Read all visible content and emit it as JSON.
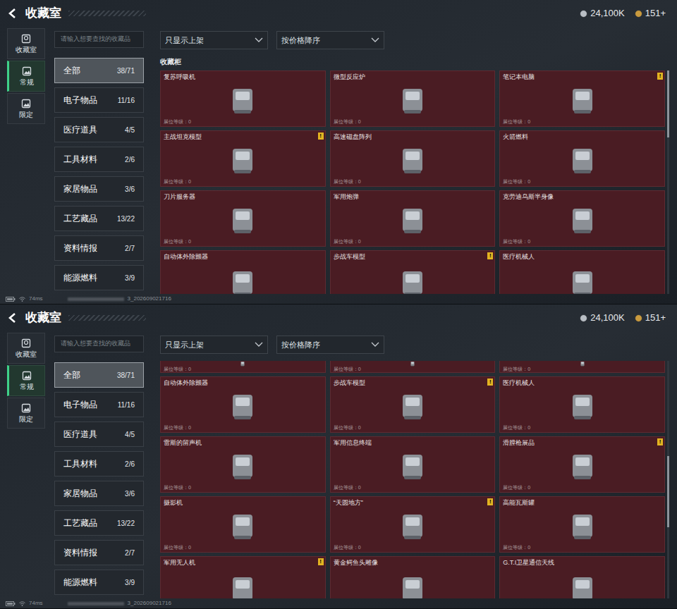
{
  "screens": [
    {
      "title": "收藏室",
      "currency": [
        {
          "value": "24,100K",
          "color": "#b9bec4"
        },
        {
          "value": "151+",
          "color": "#c99a3e"
        }
      ],
      "nav_tabs": [
        {
          "label": "收藏室",
          "selected": false
        },
        {
          "label": "常规",
          "selected": true
        },
        {
          "label": "限定",
          "selected": false
        }
      ],
      "search": {
        "placeholder": "请输入想要查找的收藏品"
      },
      "categories": [
        {
          "label": "全部",
          "count": "38/71",
          "selected": true
        },
        {
          "label": "电子物品",
          "count": "11/16",
          "selected": false
        },
        {
          "label": "医疗道具",
          "count": "4/5",
          "selected": false
        },
        {
          "label": "工具材料",
          "count": "2/6",
          "selected": false
        },
        {
          "label": "家居物品",
          "count": "3/6",
          "selected": false
        },
        {
          "label": "工艺藏品",
          "count": "13/22",
          "selected": false
        },
        {
          "label": "资料情报",
          "count": "2/7",
          "selected": false
        },
        {
          "label": "能源燃料",
          "count": "3/9",
          "selected": false
        }
      ],
      "filters": [
        "只显示上架",
        "按价格降序"
      ],
      "section_title": "收藏柜",
      "scroll_level": 0.0,
      "cards": [
        {
          "kind": "full",
          "name": "复苏呼吸机",
          "level": "展位等级：0"
        },
        {
          "kind": "full",
          "name": "微型反应炉",
          "level": "展位等级：0"
        },
        {
          "kind": "full",
          "name": "笔记本电脑",
          "level": "展位等级：0",
          "badge": "!"
        },
        {
          "kind": "full",
          "name": "主战坦克模型",
          "level": "展位等级：0",
          "badge": "!"
        },
        {
          "kind": "full",
          "name": "高速磁盘阵列",
          "level": "展位等级：0"
        },
        {
          "kind": "full",
          "name": "火箭燃料",
          "level": "展位等级：0"
        },
        {
          "kind": "full",
          "name": "刀片服务器",
          "level": "展位等级：0"
        },
        {
          "kind": "full",
          "name": "军用炮弹",
          "level": "展位等级：0"
        },
        {
          "kind": "full",
          "name": "克劳迪乌斯半身像",
          "level": "展位等级：0"
        },
        {
          "kind": "full",
          "name": "自动体外除颤器"
        },
        {
          "kind": "full",
          "name": "步战车模型",
          "badge": "!"
        },
        {
          "kind": "full",
          "name": "医疗机械人"
        }
      ],
      "status": {
        "ping": "74ms",
        "build": "3_202609021716"
      }
    },
    {
      "title": "收藏室",
      "currency": [
        {
          "value": "24,100K",
          "color": "#b9bec4"
        },
        {
          "value": "151+",
          "color": "#c99a3e"
        }
      ],
      "nav_tabs": [
        {
          "label": "收藏室",
          "selected": false
        },
        {
          "label": "常规",
          "selected": true
        },
        {
          "label": "限定",
          "selected": false
        }
      ],
      "search": {
        "placeholder": "请输入想要查找的收藏品"
      },
      "categories": [
        {
          "label": "全部",
          "count": "38/71",
          "selected": true
        },
        {
          "label": "电子物品",
          "count": "11/16",
          "selected": false
        },
        {
          "label": "医疗道具",
          "count": "4/5",
          "selected": false
        },
        {
          "label": "工具材料",
          "count": "2/6",
          "selected": false
        },
        {
          "label": "家居物品",
          "count": "3/6",
          "selected": false
        },
        {
          "label": "工艺藏品",
          "count": "13/22",
          "selected": false
        },
        {
          "label": "资料情报",
          "count": "2/7",
          "selected": false
        },
        {
          "label": "能源燃料",
          "count": "3/9",
          "selected": false
        }
      ],
      "filters": [
        "只显示上架",
        "按价格降序"
      ],
      "scroll_level": 0.4,
      "cards": [
        {
          "kind": "clipped",
          "level": "展位等级：0"
        },
        {
          "kind": "clipped",
          "level": "展位等级：0"
        },
        {
          "kind": "clipped",
          "level": "展位等级：0"
        },
        {
          "kind": "full",
          "name": "自动体外除颤器",
          "level": "展位等级：0"
        },
        {
          "kind": "full",
          "name": "步战车模型",
          "level": "展位等级：0",
          "badge": "!"
        },
        {
          "kind": "full",
          "name": "医疗机械人",
          "level": "展位等级：0"
        },
        {
          "kind": "full",
          "name": "雷斯的留声机",
          "level": "展位等级：0"
        },
        {
          "kind": "full",
          "name": "军用信息终端",
          "level": "展位等级：0"
        },
        {
          "kind": "full",
          "name": "滑膛枪展品",
          "level": "展位等级：0",
          "badge": "!"
        },
        {
          "kind": "full",
          "name": "摄影机",
          "level": "展位等级：0"
        },
        {
          "kind": "full",
          "name": "“天圆地方”",
          "level": "展位等级：0",
          "badge": "!"
        },
        {
          "kind": "full",
          "name": "高能瓦斯罐",
          "level": "展位等级：0"
        },
        {
          "kind": "full",
          "name": "军用无人机",
          "badge": "!"
        },
        {
          "kind": "full",
          "name": "黄金鳄鱼头雕像"
        },
        {
          "kind": "full",
          "name": "G.T.I卫星通信天线"
        }
      ],
      "status": {
        "ping": "74ms",
        "build": "3_202609021716"
      }
    }
  ]
}
